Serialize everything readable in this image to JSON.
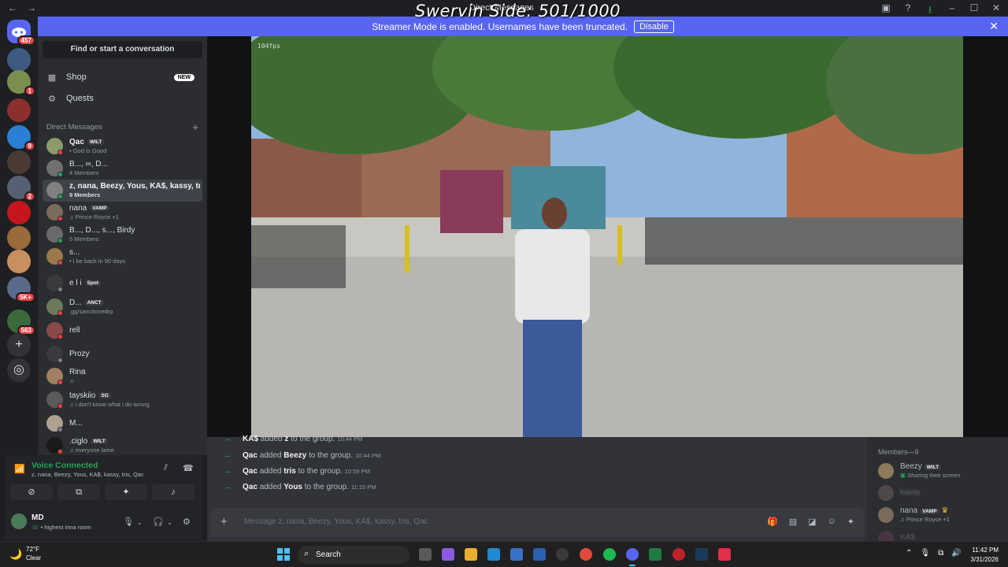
{
  "overlay_title": "Swervin Side: 501/1000",
  "window": {
    "title": "Direct Messages"
  },
  "banner": {
    "text": "Streamer Mode is enabled. Usernames have been truncated.",
    "button_label": "Disable"
  },
  "guilds": {
    "badges": [
      "457",
      "1",
      "9",
      "2",
      "5K+",
      "563"
    ]
  },
  "sidebar": {
    "find_placeholder": "Find or start a conversation",
    "shop_label": "Shop",
    "shop_badge": "NEW",
    "quests_label": "Quests",
    "dm_header": "Direct Messages",
    "dms": [
      {
        "name": "Qac",
        "tag": "WILT",
        "sub": "God Is Good"
      },
      {
        "name": "B..., ∞, D...",
        "sub": "4 Members"
      },
      {
        "name": "z, nana, Beezy, Yous, KA$, kassy, tr...",
        "sub": "9 Members"
      },
      {
        "name": "nana",
        "tag": "VAMP",
        "sub": "Prince Royce +1"
      },
      {
        "name": "B..., D..., s..., Birdy",
        "sub": "5 Members"
      },
      {
        "name": "s...",
        "sub": "i be back in 90 days"
      },
      {
        "name": "e l i",
        "tag": "Spot"
      },
      {
        "name": "D...",
        "tag": "ANCT",
        "sub": ".gg/sanctionedrp"
      },
      {
        "name": "rell"
      },
      {
        "name": "Prozy"
      },
      {
        "name": "Rina"
      },
      {
        "name": "tayskiio",
        "tag": "SG",
        "sub": "i don't know what i do wrong"
      },
      {
        "name": "M..."
      },
      {
        "name": ".ciglo",
        "tag": "WILT",
        "sub": "everyone lame"
      }
    ]
  },
  "voice": {
    "title": "Voice Connected",
    "sub": "z, nana, Beezy, Yous, KA$, kassy, tris, Qac"
  },
  "user": {
    "name": "MD",
    "status": "highest inna room"
  },
  "stream": {
    "fps": "104fps"
  },
  "messages": [
    {
      "actor": "KA$",
      "mid": "added",
      "target": "z",
      "end": "to the group.",
      "time": "10:44 PM"
    },
    {
      "actor": "Qac",
      "mid": "added",
      "target": "Beezy",
      "end": "to the group.",
      "time": "10:44 PM"
    },
    {
      "actor": "Qac",
      "mid": "added",
      "target": "tris",
      "end": "to the group.",
      "time": "10:59 PM"
    },
    {
      "actor": "Qac",
      "mid": "added",
      "target": "Yous",
      "end": "to the group.",
      "time": "11:15 PM"
    }
  ],
  "composer": {
    "placeholder": "Message z, nana, Beezy, Yous, KA$, kassy, tris, Qac"
  },
  "members": {
    "header": "Members—9",
    "list": [
      {
        "name": "Beezy",
        "tag": "WILT",
        "sub": "Sharing their screen"
      },
      {
        "name": "kassy"
      },
      {
        "name": "nana",
        "tag": "VAMP",
        "sub": "Prince Royce +1"
      },
      {
        "name": "KA$"
      }
    ]
  },
  "taskbar": {
    "temp": "72°F",
    "condition": "Clear",
    "search_label": "Search",
    "time": "11:42 PM",
    "date": "3/31/2026"
  }
}
